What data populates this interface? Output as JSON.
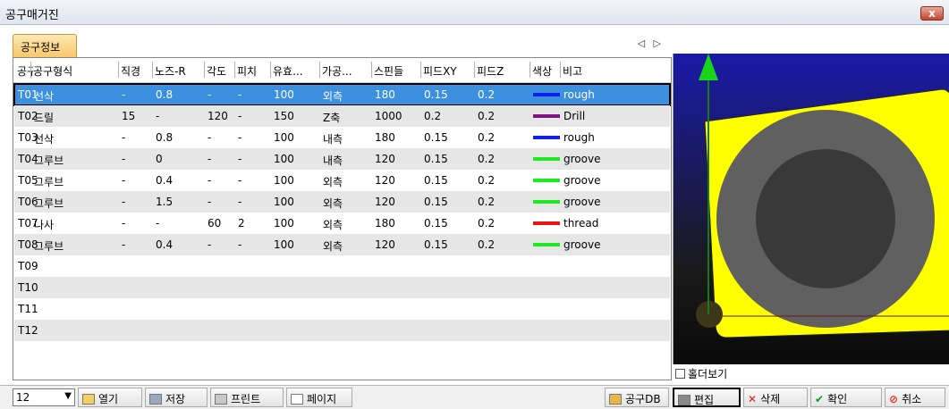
{
  "window": {
    "title": "공구매거진",
    "close": "x"
  },
  "tabs": {
    "active": "공구정보",
    "scroll": "◁ ▷"
  },
  "columns": [
    "공구",
    "공구형식",
    "직경",
    "노즈-R",
    "각도",
    "피치",
    "유효...",
    "가공...",
    "스핀들",
    "피드XY",
    "피드Z",
    "색상",
    "비고"
  ],
  "rows": [
    {
      "tool": "T01",
      "type": "선삭",
      "dia": "-",
      "nose": "0.8",
      "angle": "-",
      "pitch": "-",
      "eff": "100",
      "proc": "외측",
      "spindle": "180",
      "fxy": "0.15",
      "fz": "0.2",
      "color": "#1022e8",
      "note": "rough"
    },
    {
      "tool": "T02",
      "type": "드릴",
      "dia": "15",
      "nose": "-",
      "angle": "120",
      "pitch": "-",
      "eff": "150",
      "proc": "Z축",
      "spindle": "1000",
      "fxy": "0.2",
      "fz": "0.2",
      "color": "#7b1580",
      "note": "Drill"
    },
    {
      "tool": "T03",
      "type": "선삭",
      "dia": "-",
      "nose": "0.8",
      "angle": "-",
      "pitch": "-",
      "eff": "100",
      "proc": "내측",
      "spindle": "180",
      "fxy": "0.15",
      "fz": "0.2",
      "color": "#1022e8",
      "note": "rough"
    },
    {
      "tool": "T04",
      "type": "그루브",
      "dia": "-",
      "nose": "0",
      "angle": "-",
      "pitch": "-",
      "eff": "100",
      "proc": "내측",
      "spindle": "120",
      "fxy": "0.15",
      "fz": "0.2",
      "color": "#1cea23",
      "note": "groove"
    },
    {
      "tool": "T05",
      "type": "그루브",
      "dia": "-",
      "nose": "0.4",
      "angle": "-",
      "pitch": "-",
      "eff": "100",
      "proc": "외측",
      "spindle": "120",
      "fxy": "0.15",
      "fz": "0.2",
      "color": "#1cea23",
      "note": "groove"
    },
    {
      "tool": "T06",
      "type": "그루브",
      "dia": "-",
      "nose": "1.5",
      "angle": "-",
      "pitch": "-",
      "eff": "100",
      "proc": "외측",
      "spindle": "120",
      "fxy": "0.15",
      "fz": "0.2",
      "color": "#1cea23",
      "note": "groove"
    },
    {
      "tool": "T07",
      "type": "나사",
      "dia": "-",
      "nose": "-",
      "angle": "60",
      "pitch": "2",
      "eff": "100",
      "proc": "외측",
      "spindle": "180",
      "fxy": "0.15",
      "fz": "0.2",
      "color": "#ee1212",
      "note": "thread"
    },
    {
      "tool": "T08",
      "type": "그루브",
      "dia": "-",
      "nose": "0.4",
      "angle": "-",
      "pitch": "-",
      "eff": "100",
      "proc": "외측",
      "spindle": "120",
      "fxy": "0.15",
      "fz": "0.2",
      "color": "#1cea23",
      "note": "groove"
    },
    {
      "tool": "T09"
    },
    {
      "tool": "T10"
    },
    {
      "tool": "T11"
    },
    {
      "tool": "T12"
    }
  ],
  "preview": {
    "holder_label": "홀더보기"
  },
  "toolbar": {
    "count": "12",
    "open": "열기",
    "save": "저장",
    "print": "프린트",
    "page": "페이지",
    "tooldb": "공구DB",
    "edit": "편집",
    "delete": "삭제",
    "ok": "확인",
    "cancel": "취소"
  }
}
